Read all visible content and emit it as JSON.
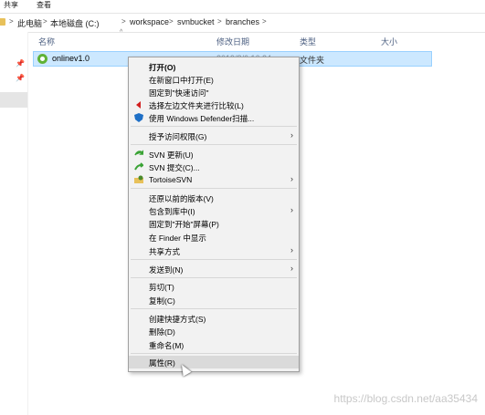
{
  "ribbon": {
    "tabs": [
      "共享",
      "查看"
    ]
  },
  "address": {
    "crumbs": [
      "此电脑",
      "本地磁盘 (C:)",
      "workspace",
      "svnbucket",
      "branches"
    ],
    "separator": ">"
  },
  "columns": {
    "name": "名称",
    "date": "修改日期",
    "type": "类型",
    "size": "大小"
  },
  "file": {
    "name": "onlinev1.0",
    "date": "2019/8/6 16:24",
    "type": "文件夹"
  },
  "menu": {
    "open": "打开(O)",
    "open_new_window": "在新窗口中打开(E)",
    "pin_quick_access": "固定到\"快速访问\"",
    "compare_left": "选择左边文件夹进行比较(L)",
    "defender": "使用 Windows Defender扫描...",
    "grant_access": "授予访问权限(G)",
    "svn_update": "SVN 更新(U)",
    "svn_commit": "SVN 提交(C)...",
    "tortoise": "TortoiseSVN",
    "restore_prev": "还原以前的版本(V)",
    "include_library": "包含到库中(I)",
    "pin_start": "固定到\"开始\"屏幕(P)",
    "finder": "在 Finder 中显示",
    "share": "共享方式",
    "send_to": "发送到(N)",
    "cut": "剪切(T)",
    "copy": "复制(C)",
    "create_shortcut": "创建快捷方式(S)",
    "delete": "删除(D)",
    "rename": "重命名(M)",
    "properties": "属性(R)"
  },
  "watermark": "https://blog.csdn.net/aa35434",
  "colors": {
    "selection": "#cce8ff",
    "menu_bg": "#f2f2f2",
    "svn_green": "#5fb236"
  }
}
